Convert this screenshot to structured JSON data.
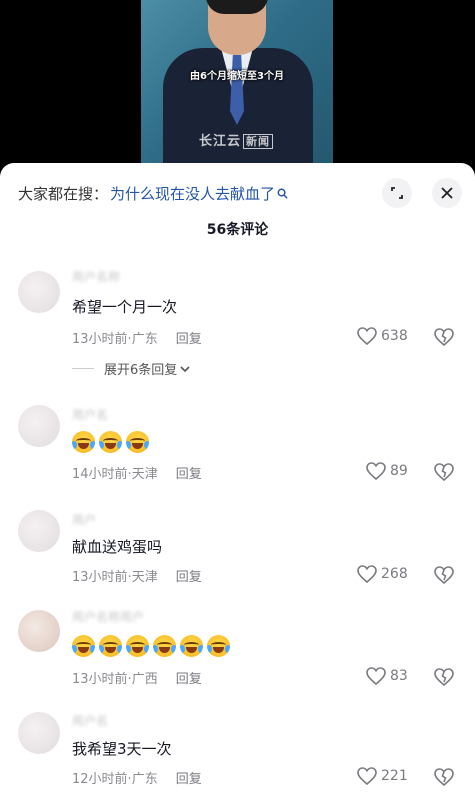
{
  "video": {
    "caption": "由6个月缩短至3个月",
    "logo_text": "长江云",
    "logo_box": "新闻"
  },
  "search": {
    "prefix": "大家都在搜：",
    "query": "为什么现在没人去献血了",
    "icon": "search-icon"
  },
  "header": {
    "comment_count_title": "56条评论",
    "fullscreen_icon": "fullscreen-icon",
    "close_icon": "close-icon"
  },
  "reply_label": "回复",
  "comments": [
    {
      "text": "希望一个月一次",
      "time": "13小时前",
      "location": "广东",
      "likes": "638",
      "expand_label": "展开6条回复"
    },
    {
      "text": "",
      "emoji": [
        "laugh-cry-emoji",
        "laugh-cry-emoji",
        "laugh-cry-emoji"
      ],
      "time": "14小时前",
      "location": "天津",
      "likes": "89"
    },
    {
      "text": "献血送鸡蛋吗",
      "time": "13小时前",
      "location": "天津",
      "likes": "268"
    },
    {
      "text": "",
      "emoji": [
        "rofl-emoji",
        "rofl-emoji",
        "rofl-emoji",
        "rofl-emoji",
        "rofl-emoji",
        "rofl-emoji"
      ],
      "time": "13小时前",
      "location": "广西",
      "likes": "83"
    },
    {
      "text": "我希望3天一次",
      "time": "12小时前",
      "location": "广东",
      "likes": "221"
    }
  ],
  "colors": {
    "link_blue": "#2456a8",
    "meta_gray": "#8a8b91",
    "text_dark": "#161823"
  }
}
